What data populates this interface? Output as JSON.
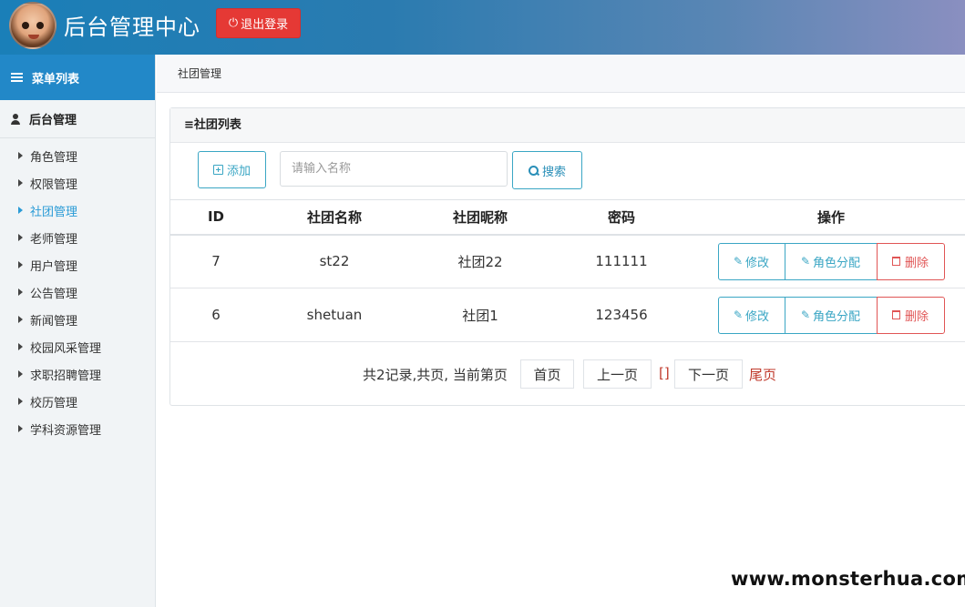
{
  "header": {
    "title": "后台管理中心",
    "logout_label": "退出登录"
  },
  "sidebar": {
    "menu_title": "菜单列表",
    "section_title": "后台管理",
    "items": [
      {
        "label": "角色管理",
        "active": false
      },
      {
        "label": "权限管理",
        "active": false
      },
      {
        "label": "社团管理",
        "active": true
      },
      {
        "label": "老师管理",
        "active": false
      },
      {
        "label": "用户管理",
        "active": false
      },
      {
        "label": "公告管理",
        "active": false
      },
      {
        "label": "新闻管理",
        "active": false
      },
      {
        "label": "校园风采管理",
        "active": false
      },
      {
        "label": "求职招聘管理",
        "active": false
      },
      {
        "label": "校历管理",
        "active": false
      },
      {
        "label": "学科资源管理",
        "active": false
      }
    ]
  },
  "breadcrumb": "社团管理",
  "panel": {
    "title": "≡社团列表",
    "add_label": "添加",
    "search_placeholder": "请输入名称",
    "search_label": "搜索"
  },
  "table": {
    "headers": [
      "ID",
      "社团名称",
      "社团昵称",
      "密码",
      "操作"
    ],
    "rows": [
      {
        "id": "7",
        "name": "st22",
        "nickname": "社团22",
        "password": "111111"
      },
      {
        "id": "6",
        "name": "shetuan",
        "nickname": "社团1",
        "password": "123456"
      }
    ],
    "edit_label": "修改",
    "role_label": "角色分配",
    "delete_label": "删除"
  },
  "pager": {
    "info": "共2记录,共页, 当前第页",
    "first": "首页",
    "prev": "上一页",
    "brackets": "[]",
    "next": "下一页",
    "last": "尾页"
  },
  "watermark": "www.monsterhua.com",
  "colors": {
    "accent": "#2288c8",
    "danger": "#e53935",
    "info": "#3aa6c4"
  }
}
